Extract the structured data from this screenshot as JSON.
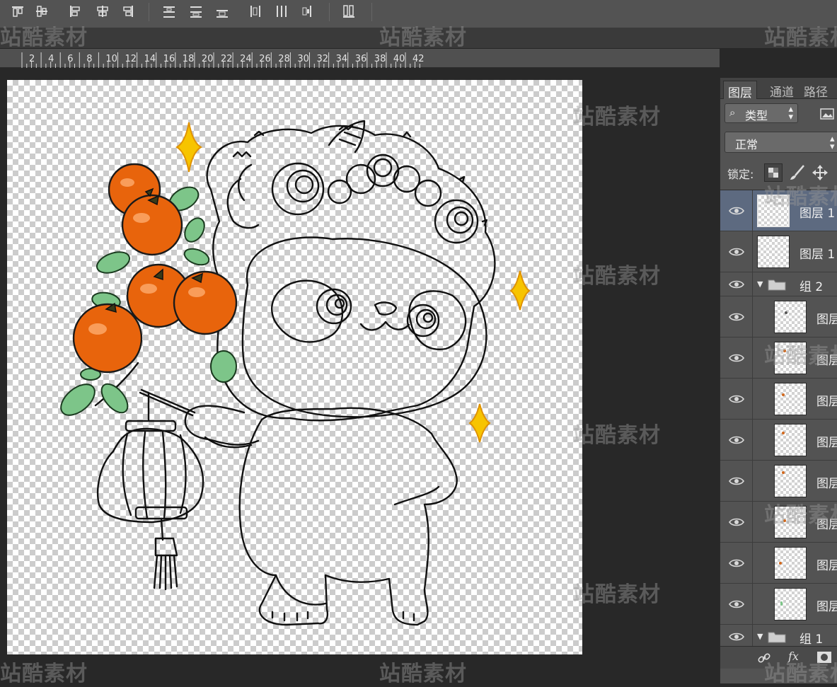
{
  "options_bar": {
    "align_tools": [
      "align-top-edges-icon",
      "align-vertical-centers-icon",
      "align-bottom-edges-icon",
      "align-left-edges-icon",
      "align-horizontal-centers-icon",
      "align-right-edges-icon",
      "distribute-top-icon",
      "distribute-vertical-centers-icon",
      "distribute-bottom-icon",
      "distribute-left-icon",
      "distribute-horizontal-centers-icon",
      "distribute-right-icon",
      "auto-align-icon"
    ]
  },
  "ruler": {
    "labels": [
      "2",
      "4",
      "6",
      "8",
      "10",
      "12",
      "14",
      "16",
      "18",
      "20",
      "22",
      "24",
      "26",
      "28",
      "30",
      "32",
      "34",
      "36",
      "38",
      "40",
      "42"
    ]
  },
  "layers_panel": {
    "tabs": [
      {
        "label": "图层",
        "active": true
      },
      {
        "label": "通道",
        "active": false
      },
      {
        "label": "路径",
        "active": false
      }
    ],
    "filter": {
      "label": "类型"
    },
    "blend_mode": "正常",
    "lock_label": "锁定:",
    "layers": [
      {
        "name": "图层 1",
        "kind": "layer",
        "selected": true
      },
      {
        "name": "图层 1",
        "kind": "layer",
        "selected": false
      },
      {
        "name": "组 2",
        "kind": "group",
        "expanded": true
      },
      {
        "name": "图层",
        "kind": "layer",
        "indent": true
      },
      {
        "name": "图层",
        "kind": "layer",
        "indent": true
      },
      {
        "name": "图层",
        "kind": "layer",
        "indent": true
      },
      {
        "name": "图层",
        "kind": "layer",
        "indent": true
      },
      {
        "name": "图层",
        "kind": "layer",
        "indent": true
      },
      {
        "name": "图层",
        "kind": "layer",
        "indent": true
      },
      {
        "name": "图层",
        "kind": "layer",
        "indent": true
      },
      {
        "name": "图层",
        "kind": "layer",
        "indent": true
      },
      {
        "name": "组 1",
        "kind": "group",
        "expanded": true
      }
    ],
    "footer": {
      "fx_label": "fx"
    }
  },
  "watermark_text": "站酷素材",
  "colors": {
    "persimmon": "#e8640c",
    "leaf": "#7dc589",
    "sparkle": "#f7c400",
    "selection": "#5d6a80"
  }
}
